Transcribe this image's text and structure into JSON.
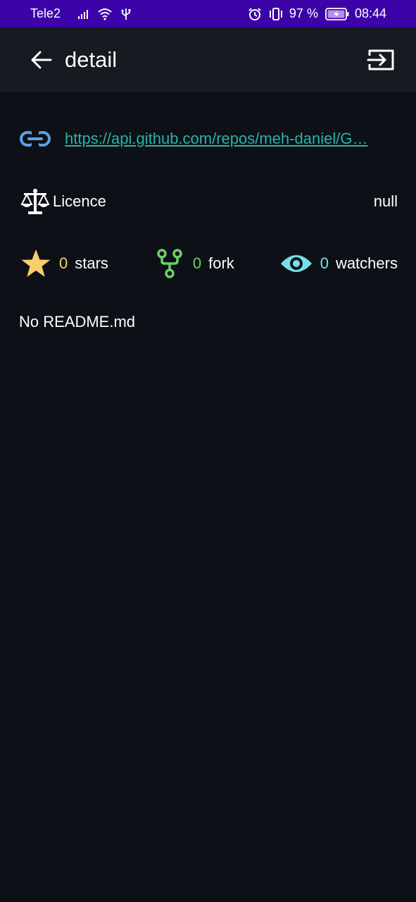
{
  "status_bar": {
    "carrier": "Tele2",
    "battery_percent": "97 %",
    "time": "08:44",
    "icons": [
      "signal-icon",
      "wifi-icon",
      "usb-icon",
      "alarm-icon",
      "vibrate-icon",
      "battery-charging-icon"
    ]
  },
  "app_bar": {
    "title": "detail",
    "back_icon": "arrow-left-icon",
    "action_icon": "open-in-icon"
  },
  "repo": {
    "url": "https://api.github.com/repos/meh-daniel/G…",
    "link_icon": "link-icon",
    "link_color": "#2bb3a6"
  },
  "licence": {
    "label": "Licence",
    "value": "null",
    "icon": "scale-icon"
  },
  "stats": {
    "stars": {
      "count": "0",
      "label": "stars",
      "icon": "star-icon",
      "color": "#f6cf6b"
    },
    "forks": {
      "count": "0",
      "label": "fork",
      "icon": "fork-icon",
      "color": "#6fcf6a"
    },
    "watchers": {
      "count": "0",
      "label": "watchers",
      "icon": "eye-icon",
      "color": "#77e0e6"
    }
  },
  "readme": {
    "text": "No README.md"
  },
  "colors": {
    "status_bar_bg": "#3c04a8",
    "app_bar_bg": "#161b22",
    "page_bg": "#0d1117"
  }
}
